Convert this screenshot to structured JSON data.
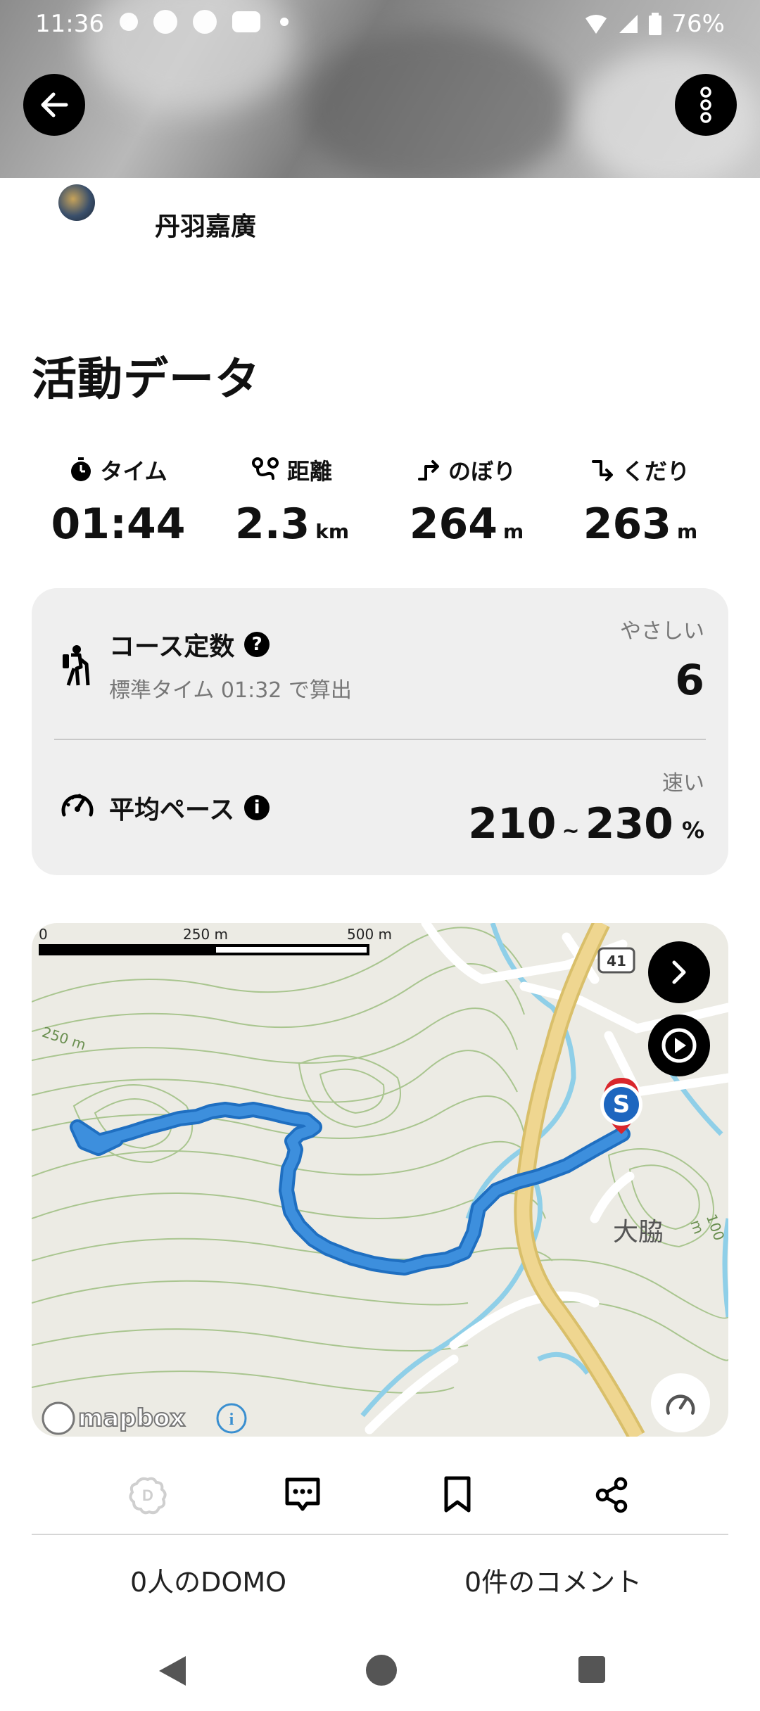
{
  "status_bar": {
    "time": "11:36",
    "battery": "76%",
    "notification_icons": [
      "settings-icon",
      "facebook-icon",
      "d-app-icon",
      "youtube-icon"
    ]
  },
  "header": {
    "back_icon": "arrow-left-icon",
    "menu_icon": "more-vertical-icon"
  },
  "user": {
    "name": "丹羽嘉廣"
  },
  "section": {
    "title": "活動データ"
  },
  "stats": [
    {
      "label": "タイム",
      "value": "01:44",
      "unit": "",
      "icon": "stopwatch-icon"
    },
    {
      "label": "距離",
      "value": "2.3",
      "unit": "km",
      "icon": "route-icon"
    },
    {
      "label": "のぼり",
      "value": "264",
      "unit": "m",
      "icon": "ascent-icon"
    },
    {
      "label": "くだり",
      "value": "263",
      "unit": "m",
      "icon": "descent-icon"
    }
  ],
  "course": {
    "title": "コース定数",
    "subtitle": "標準タイム 01:32 で算出",
    "tag": "やさしい",
    "value": "6",
    "help_icon": "?"
  },
  "pace": {
    "title": "平均ペース",
    "tag": "速い",
    "value_low": "210",
    "separator": "~",
    "value_high": "230",
    "unit": "%",
    "info_icon": "i"
  },
  "map": {
    "scale_labels": [
      "0",
      "250 m",
      "500 m"
    ],
    "contour_labels": [
      "250 m",
      "100 m"
    ],
    "road_number": "41",
    "place_name": "大脇",
    "start_marker": "S",
    "attribution": "mapbox"
  },
  "actions": {
    "domo_count": "0人のDOMO",
    "comment_count": "0件のコメント"
  },
  "colors": {
    "route": "#3d8fdd",
    "accent_black": "#000000",
    "card_bg": "#efefef",
    "road": "#e4c46b",
    "water": "#8fcfe8"
  }
}
